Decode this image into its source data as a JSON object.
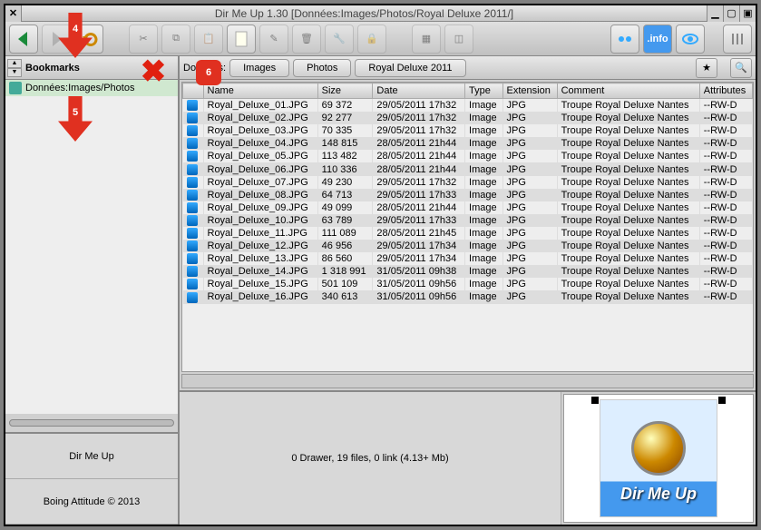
{
  "window": {
    "title": "Dir Me Up 1.30 [Données:Images/Photos/Royal Deluxe 2011/]"
  },
  "sidebar": {
    "bookmarks_label": "Bookmarks",
    "items": [
      {
        "label": "Données:Images/Photos"
      }
    ],
    "info1": "Dir Me Up",
    "info2": "Boing Attitude ©  2013"
  },
  "breadcrumb": {
    "label": "Données:",
    "parts": [
      "Images",
      "Photos",
      "Royal Deluxe 2011"
    ]
  },
  "columns": [
    "Name",
    "Size",
    "Date",
    "Type",
    "Extension",
    "Comment",
    "Attributes"
  ],
  "files": [
    {
      "name": "Royal_Deluxe_01.JPG",
      "size": "69 372",
      "date": "29/05/2011 17h32",
      "type": "Image",
      "ext": "JPG",
      "comment": "Troupe Royal Deluxe Nantes",
      "attr": "--RW-D"
    },
    {
      "name": "Royal_Deluxe_02.JPG",
      "size": "92 277",
      "date": "29/05/2011 17h32",
      "type": "Image",
      "ext": "JPG",
      "comment": "Troupe Royal Deluxe Nantes",
      "attr": "--RW-D"
    },
    {
      "name": "Royal_Deluxe_03.JPG",
      "size": "70 335",
      "date": "29/05/2011 17h32",
      "type": "Image",
      "ext": "JPG",
      "comment": "Troupe Royal Deluxe Nantes",
      "attr": "--RW-D"
    },
    {
      "name": "Royal_Deluxe_04.JPG",
      "size": "148 815",
      "date": "28/05/2011 21h44",
      "type": "Image",
      "ext": "JPG",
      "comment": "Troupe Royal Deluxe Nantes",
      "attr": "--RW-D"
    },
    {
      "name": "Royal_Deluxe_05.JPG",
      "size": "113 482",
      "date": "28/05/2011 21h44",
      "type": "Image",
      "ext": "JPG",
      "comment": "Troupe Royal Deluxe Nantes",
      "attr": "--RW-D"
    },
    {
      "name": "Royal_Deluxe_06.JPG",
      "size": "110 336",
      "date": "28/05/2011 21h44",
      "type": "Image",
      "ext": "JPG",
      "comment": "Troupe Royal Deluxe Nantes",
      "attr": "--RW-D"
    },
    {
      "name": "Royal_Deluxe_07.JPG",
      "size": "49 230",
      "date": "29/05/2011 17h32",
      "type": "Image",
      "ext": "JPG",
      "comment": "Troupe Royal Deluxe Nantes",
      "attr": "--RW-D"
    },
    {
      "name": "Royal_Deluxe_08.JPG",
      "size": "64 713",
      "date": "29/05/2011 17h33",
      "type": "Image",
      "ext": "JPG",
      "comment": "Troupe Royal Deluxe Nantes",
      "attr": "--RW-D"
    },
    {
      "name": "Royal_Deluxe_09.JPG",
      "size": "49 099",
      "date": "28/05/2011 21h44",
      "type": "Image",
      "ext": "JPG",
      "comment": "Troupe Royal Deluxe Nantes",
      "attr": "--RW-D"
    },
    {
      "name": "Royal_Deluxe_10.JPG",
      "size": "63 789",
      "date": "29/05/2011 17h33",
      "type": "Image",
      "ext": "JPG",
      "comment": "Troupe Royal Deluxe Nantes",
      "attr": "--RW-D"
    },
    {
      "name": "Royal_Deluxe_11.JPG",
      "size": "111 089",
      "date": "28/05/2011 21h45",
      "type": "Image",
      "ext": "JPG",
      "comment": "Troupe Royal Deluxe Nantes",
      "attr": "--RW-D"
    },
    {
      "name": "Royal_Deluxe_12.JPG",
      "size": "46 956",
      "date": "29/05/2011 17h34",
      "type": "Image",
      "ext": "JPG",
      "comment": "Troupe Royal Deluxe Nantes",
      "attr": "--RW-D"
    },
    {
      "name": "Royal_Deluxe_13.JPG",
      "size": "86 560",
      "date": "29/05/2011 17h34",
      "type": "Image",
      "ext": "JPG",
      "comment": "Troupe Royal Deluxe Nantes",
      "attr": "--RW-D"
    },
    {
      "name": "Royal_Deluxe_14.JPG",
      "size": "1 318 991",
      "date": "31/05/2011 09h38",
      "type": "Image",
      "ext": "JPG",
      "comment": "Troupe Royal Deluxe Nantes",
      "attr": "--RW-D"
    },
    {
      "name": "Royal_Deluxe_15.JPG",
      "size": "501 109",
      "date": "31/05/2011 09h56",
      "type": "Image",
      "ext": "JPG",
      "comment": "Troupe Royal Deluxe Nantes",
      "attr": "--RW-D"
    },
    {
      "name": "Royal_Deluxe_16.JPG",
      "size": "340 613",
      "date": "31/05/2011 09h56",
      "type": "Image",
      "ext": "JPG",
      "comment": "Troupe Royal Deluxe Nantes",
      "attr": "--RW-D"
    }
  ],
  "status": "0 Drawer, 19 files, 0 link (4.13+ Mb)",
  "preview": {
    "logo_text": "Dir Me Up"
  },
  "callouts": {
    "c4": "4",
    "c5": "5",
    "c6": "6"
  }
}
